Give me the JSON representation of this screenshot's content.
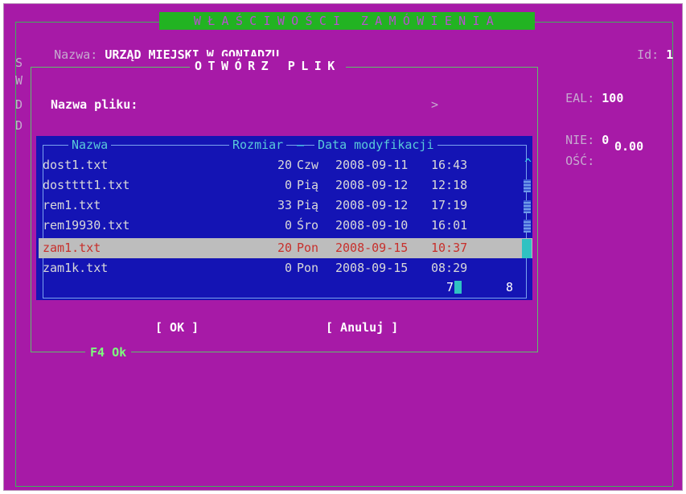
{
  "window": {
    "title": "WŁAŚCIWOŚCI ZAMÓWIENIA",
    "name_label": "Nazwa:",
    "name_value": "URZĄD MIEJSKI W GONIĄDZU",
    "id_label": "Id:",
    "id_value": "1",
    "side_letters": [
      "S",
      "W",
      "D",
      "D"
    ],
    "right_fields": [
      {
        "label": "EAL:",
        "value": "100"
      },
      {
        "label": "NIE:",
        "value": "0"
      },
      {
        "label": "OŚĆ:",
        "value": "0.00"
      }
    ]
  },
  "dialog": {
    "title": "OTWÓRZ PLIK",
    "filename_label": "Nazwa pliku:",
    "filename_value": "",
    "filename_arrow": ">",
    "columns": {
      "name": "Nazwa",
      "size": "Rozmiar",
      "date": "Data modyfikacji"
    },
    "files": [
      {
        "name": "dost1.txt",
        "size": "20",
        "day": "Czw",
        "date": "2008-09-11",
        "time": "16:43",
        "selected": false
      },
      {
        "name": "dostttt1.txt",
        "size": "0",
        "day": "Pią",
        "date": "2008-09-12",
        "time": "12:18",
        "selected": false
      },
      {
        "name": "rem1.txt",
        "size": "33",
        "day": "Pią",
        "date": "2008-09-12",
        "time": "17:19",
        "selected": false
      },
      {
        "name": "rem19930.txt",
        "size": "0",
        "day": "Śro",
        "date": "2008-09-10",
        "time": "16:01",
        "selected": false
      },
      {
        "name": "zam1.txt",
        "size": "20",
        "day": "Pon",
        "date": "2008-09-15",
        "time": "10:37",
        "selected": true
      },
      {
        "name": "zam1k.txt",
        "size": "0",
        "day": "Pon",
        "date": "2008-09-15",
        "time": "08:29",
        "selected": false
      }
    ],
    "position": "7",
    "total": "8",
    "ok_button": "[  OK  ]",
    "cancel_button": "[ Anuluj ]",
    "footer_hint": "F4 Ok"
  },
  "colors": {
    "background": "#a71aa7",
    "list_bg": "#1414b4",
    "selection_bg": "#bdbdbd",
    "selection_text": "#c7302c",
    "title_bar": "#22b322",
    "hint_text": "#7dff7d"
  }
}
